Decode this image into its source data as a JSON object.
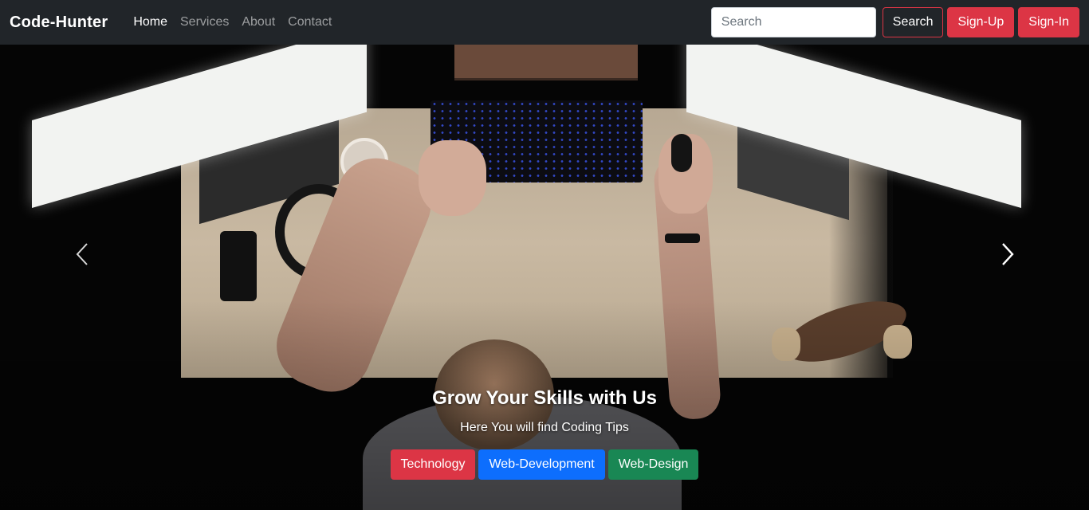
{
  "navbar": {
    "brand": "Code-Hunter",
    "links": [
      {
        "label": "Home",
        "active": true
      },
      {
        "label": "Services",
        "active": false
      },
      {
        "label": "About",
        "active": false
      },
      {
        "label": "Contact",
        "active": false
      }
    ],
    "search": {
      "placeholder": "Search",
      "value": ""
    },
    "search_button": "Search",
    "signup_button": "Sign-Up",
    "signin_button": "Sign-In"
  },
  "carousel": {
    "prev_icon": "chevron-left-icon",
    "next_icon": "chevron-right-icon",
    "caption": {
      "title": "Grow Your Skills with Us",
      "subtitle": "Here You will find Coding Tips",
      "buttons": [
        {
          "label": "Technology",
          "color": "#dc3545"
        },
        {
          "label": "Web-Development",
          "color": "#0d6efd"
        },
        {
          "label": "Web-Design",
          "color": "#198754"
        }
      ]
    }
  },
  "colors": {
    "navbar_bg": "#212529",
    "danger": "#dc3545",
    "primary": "#0d6efd",
    "success": "#198754"
  }
}
